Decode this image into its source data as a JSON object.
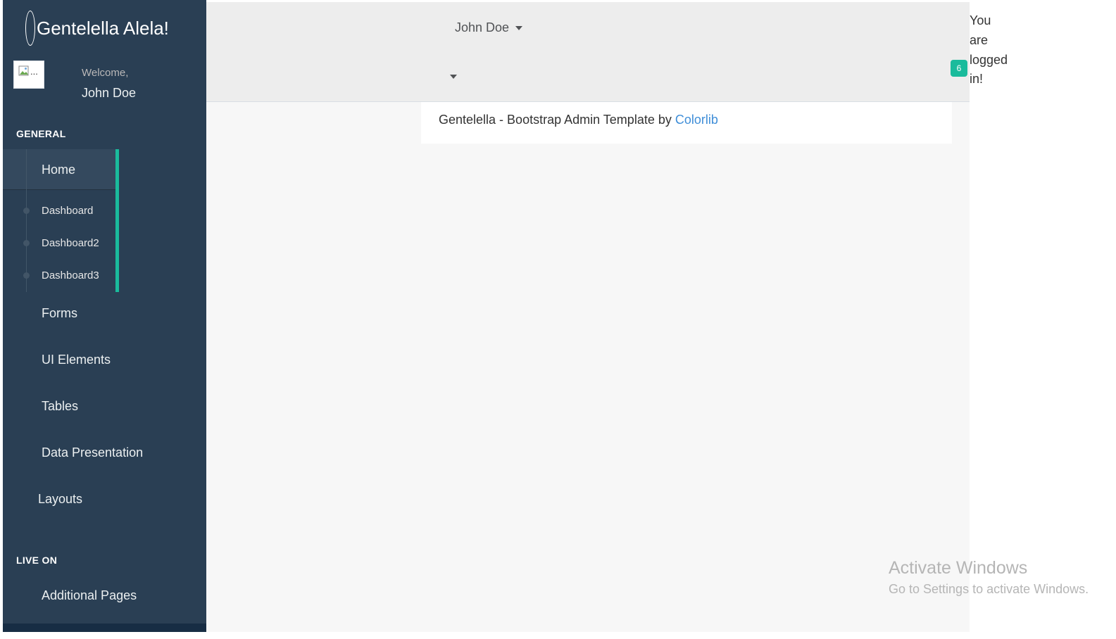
{
  "sidebar": {
    "brand": "Gentelella Alela!",
    "avatar_alt": "...",
    "welcome": "Welcome,",
    "user_name": "John Doe",
    "sections": {
      "general": "GENERAL",
      "live_on": "LIVE ON"
    },
    "home": {
      "label": "Home",
      "children": [
        "Dashboard",
        "Dashboard2",
        "Dashboard3"
      ]
    },
    "items": [
      "Forms",
      "UI Elements",
      "Tables",
      "Data Presentation",
      "Layouts"
    ],
    "live_items": [
      "Additional Pages"
    ]
  },
  "topnav": {
    "user_name": "John Doe",
    "badge_count": "6"
  },
  "footer": {
    "text": "Gentelella - Bootstrap Admin Template by ",
    "link": "Colorlib"
  },
  "status": {
    "words": [
      "You",
      "are",
      "logged",
      "in!"
    ]
  },
  "watermark": {
    "title": "Activate Windows",
    "subtitle": "Go to Settings to activate Windows."
  },
  "colors": {
    "sidebar_bg": "#2a3f54",
    "accent": "#1abb9c",
    "link": "#3f8ed8",
    "topnav_bg": "#ededed"
  }
}
